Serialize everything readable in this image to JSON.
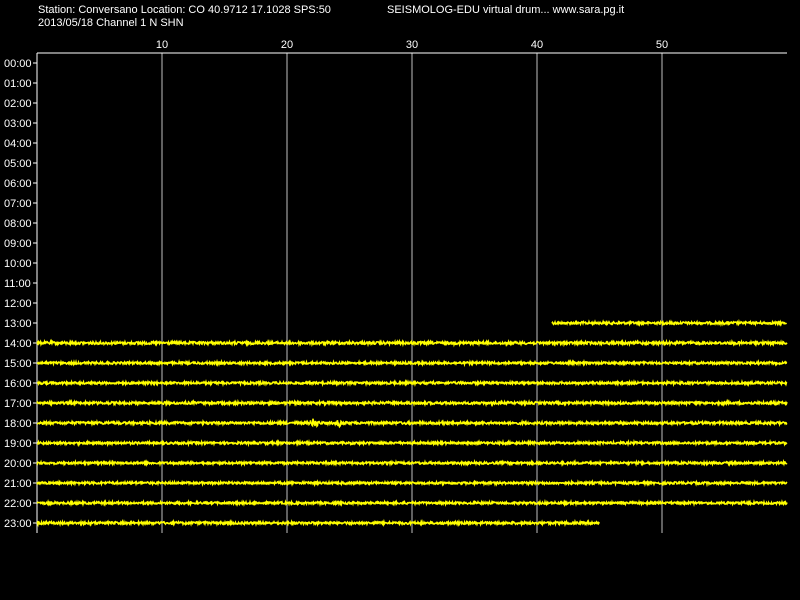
{
  "header": {
    "station_line": "Station: Conversano Location: CO 40.9712 17.1028 SPS:50",
    "app_line": "SEISMOLOG-EDU virtual drum... www.sara.pg.it",
    "date_line": "2013/05/18  Channel 1 N SHN"
  },
  "colors": {
    "background": "#000000",
    "trace": "#ffff00",
    "grid": "#ffffff",
    "text": "#ffffff"
  },
  "chart_data": {
    "type": "line",
    "title": "",
    "xlabel": "",
    "ylabel": "",
    "xlim": [
      0,
      60
    ],
    "x_ticks": [
      10,
      20,
      30,
      40,
      50
    ],
    "y_tick_labels": [
      "00:00",
      "01:00",
      "02:00",
      "03:00",
      "04:00",
      "05:00",
      "06:00",
      "07:00",
      "08:00",
      "09:00",
      "10:00",
      "11:00",
      "12:00",
      "13:00",
      "14:00",
      "15:00",
      "16:00",
      "17:00",
      "18:00",
      "19:00",
      "20:00",
      "21:00",
      "22:00",
      "23:00"
    ],
    "grid": true,
    "legend": "none",
    "series": [
      {
        "hour": "13:00",
        "start_min": 41.2,
        "end_min": 60,
        "amplitude": 1.2
      },
      {
        "hour": "14:00",
        "start_min": 0,
        "end_min": 60,
        "amplitude": 1.3
      },
      {
        "hour": "15:00",
        "start_min": 0,
        "end_min": 60,
        "amplitude": 1.1
      },
      {
        "hour": "16:00",
        "start_min": 0,
        "end_min": 60,
        "amplitude": 1.1
      },
      {
        "hour": "17:00",
        "start_min": 0,
        "end_min": 60,
        "amplitude": 1.2
      },
      {
        "hour": "18:00",
        "start_min": 0,
        "end_min": 60,
        "amplitude": 1.2,
        "events": [
          {
            "min": 22.2,
            "amplitude": 5.5
          },
          {
            "min": 24.2,
            "amplitude": 4
          },
          {
            "min": 32.5,
            "amplitude": 2.2
          }
        ]
      },
      {
        "hour": "19:00",
        "start_min": 0,
        "end_min": 60,
        "amplitude": 1.1
      },
      {
        "hour": "20:00",
        "start_min": 0,
        "end_min": 60,
        "amplitude": 1.1
      },
      {
        "hour": "21:00",
        "start_min": 0,
        "end_min": 60,
        "amplitude": 1.1
      },
      {
        "hour": "22:00",
        "start_min": 0,
        "end_min": 60,
        "amplitude": 1.1
      },
      {
        "hour": "23:00",
        "start_min": 0,
        "end_min": 45.0,
        "amplitude": 1.2
      }
    ]
  }
}
